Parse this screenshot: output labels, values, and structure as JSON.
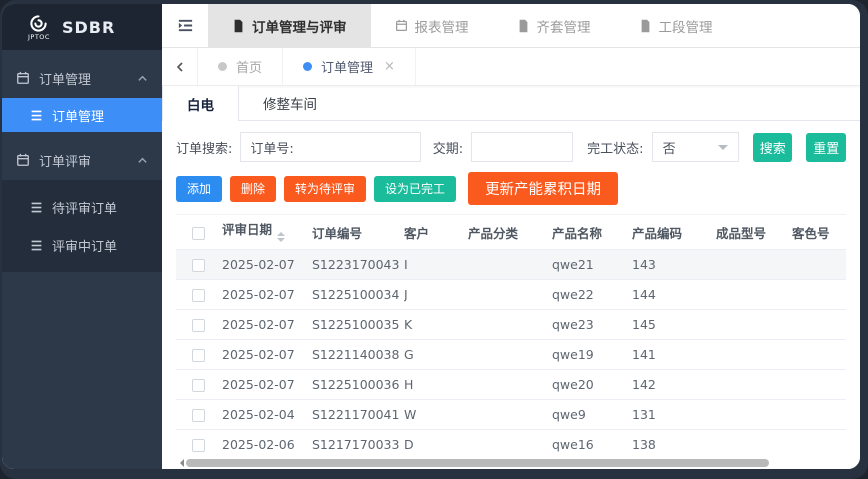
{
  "app": {
    "logo_brand": "JPTOC",
    "logo_title": "SDBR"
  },
  "colors": {
    "sidebar_bg": "#2d3949",
    "submenu_bg": "#232d3b",
    "logo_bg": "#1c2531",
    "active_blue": "#3e8ef7",
    "teal": "#1abc9c",
    "orange": "#fb5a1e",
    "blue": "#2d8cf0",
    "active_top_tab_bg": "#e4e4e4"
  },
  "sidebar": {
    "groups": [
      {
        "label": "订单管理",
        "children": [
          {
            "label": "订单管理",
            "active": true
          }
        ]
      },
      {
        "label": "订单评审",
        "children": [
          {
            "label": "待评审订单"
          },
          {
            "label": "评审中订单"
          }
        ]
      }
    ]
  },
  "topbar": {
    "tabs": [
      {
        "label": "订单管理与评审",
        "active": true
      },
      {
        "label": "报表管理"
      },
      {
        "label": "齐套管理"
      },
      {
        "label": "工段管理"
      }
    ]
  },
  "breadcrumb": {
    "tags": [
      {
        "label": "首页",
        "active": false
      },
      {
        "label": "订单管理",
        "active": true,
        "close": "×"
      }
    ]
  },
  "workshop_tabs": [
    {
      "label": "白电",
      "active": true
    },
    {
      "label": "修整车间"
    }
  ],
  "search": {
    "section_label": "订单搜索:",
    "order_no_label": "订单号:",
    "order_no_value": "",
    "delivery_label": "交期:",
    "delivery_value": "",
    "status_label": "完工状态:",
    "status_value": "否",
    "search_button": "搜索",
    "reset_button": "重置"
  },
  "actions": {
    "add": "添加",
    "delete": "删除",
    "to_pending_review": "转为待评审",
    "set_completed": "设为已完工",
    "update_capacity_date": "更新产能累积日期"
  },
  "table": {
    "columns": [
      "评审日期",
      "订单编号",
      "客户",
      "产品分类",
      "产品名称",
      "产品编码",
      "成品型号",
      "客色号"
    ],
    "rows": [
      [
        "2025-02-07",
        "S1223170043",
        "I",
        "",
        "qwe21",
        "143",
        "",
        ""
      ],
      [
        "2025-02-07",
        "S1225100034",
        "J",
        "",
        "qwe22",
        "144",
        "",
        ""
      ],
      [
        "2025-02-07",
        "S1225100035",
        "K",
        "",
        "qwe23",
        "145",
        "",
        ""
      ],
      [
        "2025-02-07",
        "S1221140038",
        "G",
        "",
        "qwe19",
        "141",
        "",
        ""
      ],
      [
        "2025-02-07",
        "S1225100036",
        "H",
        "",
        "qwe20",
        "142",
        "",
        ""
      ],
      [
        "2025-02-04",
        "S1221170041",
        "W",
        "",
        "qwe9",
        "131",
        "",
        ""
      ],
      [
        "2025-02-06",
        "S1217170033",
        "D",
        "",
        "qwe16",
        "138",
        "",
        ""
      ]
    ]
  }
}
